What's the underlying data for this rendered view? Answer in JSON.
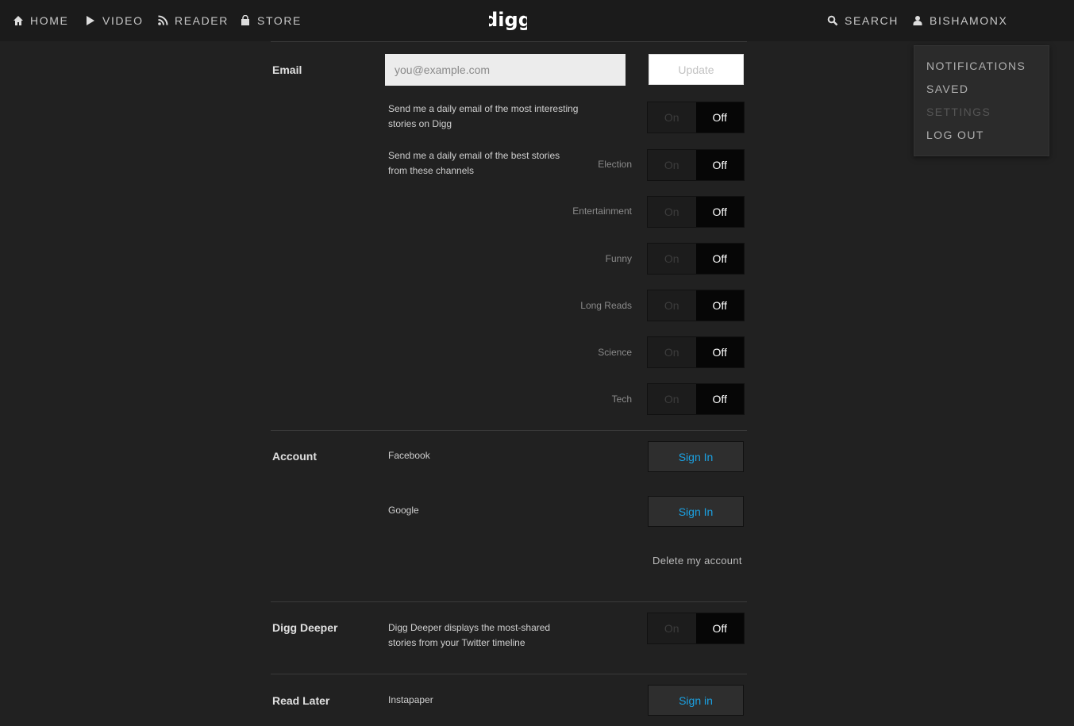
{
  "nav": {
    "left": [
      {
        "label": "HOME",
        "icon": "home-icon"
      },
      {
        "label": "VIDEO",
        "icon": "play-icon"
      },
      {
        "label": "READER",
        "icon": "rss-icon"
      },
      {
        "label": "STORE",
        "icon": "bag-icon"
      }
    ],
    "logo": "digg",
    "search_label": "SEARCH",
    "user_label": "BISHAMONX"
  },
  "dropdown": {
    "items": [
      "NOTIFICATIONS",
      "SAVED",
      "SETTINGS",
      "LOG OUT"
    ]
  },
  "email": {
    "label": "Email",
    "placeholder": "you@example.com",
    "update_label": "Update",
    "daily_desc": "Send me a daily email of the most interesting stories on Digg",
    "channels_desc": "Send me a daily email of the best stories from these channels",
    "channels": [
      "Election",
      "Entertainment",
      "Funny",
      "Long Reads",
      "Science",
      "Tech"
    ]
  },
  "toggle": {
    "on": "On",
    "off": "Off"
  },
  "account": {
    "label": "Account",
    "providers": [
      "Facebook",
      "Google"
    ],
    "signin_label": "Sign In",
    "delete_label": "Delete my account"
  },
  "digg_deeper": {
    "label": "Digg Deeper",
    "desc": "Digg Deeper displays the most-shared stories from your Twitter timeline"
  },
  "read_later": {
    "label": "Read Later",
    "provider": "Instapaper",
    "signin_label": "Sign in"
  },
  "colors": {
    "accent": "#1ba1e2",
    "background": "#212121"
  }
}
